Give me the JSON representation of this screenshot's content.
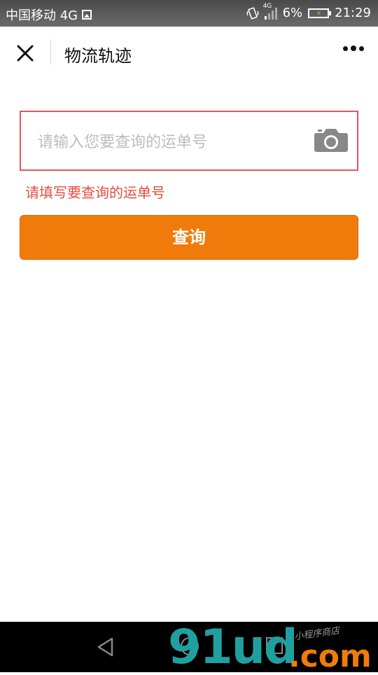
{
  "status_bar": {
    "carrier": "中国移动 4G",
    "network_tag": "4G",
    "battery_percent": "6%",
    "time": "21:29"
  },
  "nav": {
    "title": "物流轨迹"
  },
  "search": {
    "placeholder": "请输入您要查询的运单号",
    "value": "",
    "error": "请填写要查询的运单号"
  },
  "actions": {
    "query_label": "查询"
  },
  "icons": {
    "close": "close-icon",
    "more": "more-icon",
    "camera": "camera-icon",
    "back": "back-icon",
    "home": "home-icon",
    "recent": "recent-apps-icon"
  },
  "colors": {
    "accent": "#f07b0a",
    "error": "#e74c3c",
    "input_border": "#e75361"
  },
  "watermark": {
    "brand": "91ud",
    "domain": ".com",
    "tagline": "小程序商店"
  }
}
